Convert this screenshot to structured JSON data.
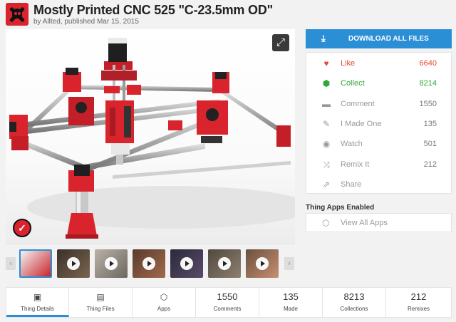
{
  "header": {
    "title": "Mostly Printed CNC 525 \"C-23.5mm OD\"",
    "byline": "by Allted, published Mar 15, 2015"
  },
  "viewer": {
    "expand_icon": "expand-icon",
    "badge_icon": "check-badge-icon"
  },
  "thumbnails": [
    {
      "kind": "image",
      "colors": [
        "#f4f4f4",
        "#c8242a"
      ]
    },
    {
      "kind": "video",
      "colors": [
        "#3a3028",
        "#7a6550"
      ]
    },
    {
      "kind": "video",
      "colors": [
        "#b9b2a8",
        "#6e6760"
      ]
    },
    {
      "kind": "video",
      "colors": [
        "#5a3a30",
        "#a06a4a"
      ]
    },
    {
      "kind": "video",
      "colors": [
        "#2a2a3a",
        "#5a4a6a"
      ]
    },
    {
      "kind": "video",
      "colors": [
        "#504840",
        "#8e8070"
      ]
    },
    {
      "kind": "video",
      "colors": [
        "#6a5040",
        "#c89070"
      ]
    }
  ],
  "download": {
    "label": "DOWNLOAD ALL FILES",
    "icon": "download-icon"
  },
  "actions": [
    {
      "name": "like",
      "label": "Like",
      "count": "6640",
      "icon": "heart-icon",
      "glyph": "♥",
      "color": "#e8482e",
      "count_color": "#e8482e"
    },
    {
      "name": "collect",
      "label": "Collect",
      "count": "8214",
      "icon": "collect-icon",
      "glyph": "⬢",
      "color": "#2ea83a",
      "count_color": "#2ea83a"
    },
    {
      "name": "comment",
      "label": "Comment",
      "count": "1550",
      "icon": "comment-icon",
      "glyph": "▬",
      "color": "#999999",
      "count_color": "#777777"
    },
    {
      "name": "i-made-one",
      "label": "I Made One",
      "count": "135",
      "icon": "edit-icon",
      "glyph": "✎",
      "color": "#999999",
      "count_color": "#777777"
    },
    {
      "name": "watch",
      "label": "Watch",
      "count": "501",
      "icon": "eye-icon",
      "glyph": "◉",
      "color": "#999999",
      "count_color": "#777777"
    },
    {
      "name": "remix-it",
      "label": "Remix It",
      "count": "212",
      "icon": "shuffle-icon",
      "glyph": "⤨",
      "color": "#999999",
      "count_color": "#777777"
    },
    {
      "name": "share",
      "label": "Share",
      "count": "",
      "icon": "share-icon",
      "glyph": "⇗",
      "color": "#999999",
      "count_color": "#777777"
    }
  ],
  "apps": {
    "title": "Thing Apps Enabled",
    "view_all": "View All Apps",
    "icon": "cube-icon"
  },
  "tabs": [
    {
      "name": "thing-details",
      "label": "Thing Details",
      "icon": "details-icon",
      "glyph": "▣",
      "active": true
    },
    {
      "name": "thing-files",
      "label": "Thing Files",
      "icon": "folder-icon",
      "glyph": "▤",
      "active": false
    },
    {
      "name": "apps",
      "label": "Apps",
      "icon": "cube-icon",
      "glyph": "⬡",
      "active": false
    },
    {
      "name": "comments",
      "label": "Comments",
      "num": "1550",
      "active": false
    },
    {
      "name": "made",
      "label": "Made",
      "num": "135",
      "active": false
    },
    {
      "name": "collections",
      "label": "Collections",
      "num": "8213",
      "active": false
    },
    {
      "name": "remixes",
      "label": "Remixes",
      "num": "212",
      "active": false
    }
  ],
  "colors": {
    "accent": "#2b8fd6",
    "brand": "#d9232d"
  }
}
